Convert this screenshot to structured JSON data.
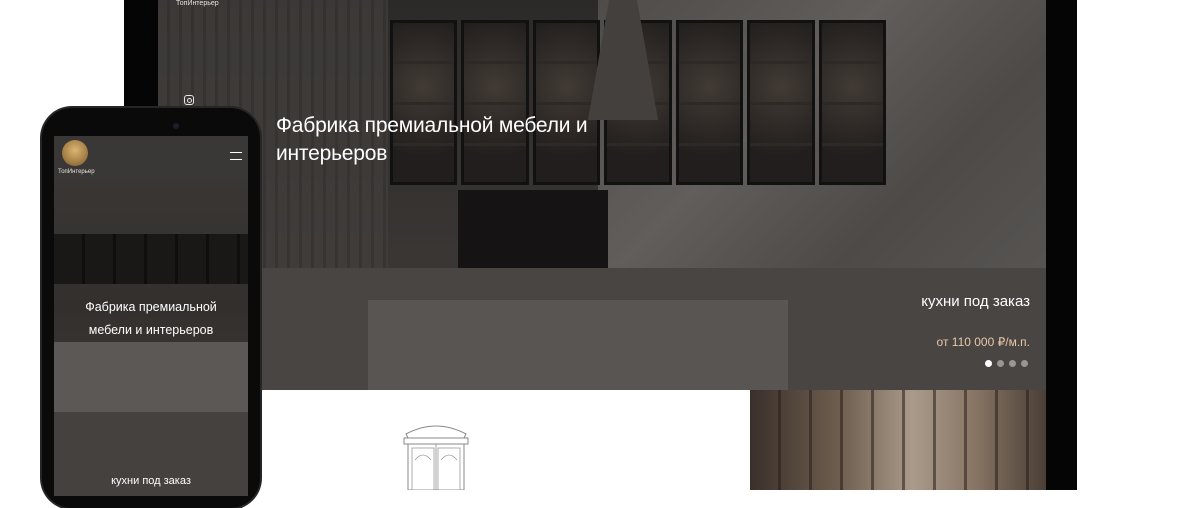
{
  "desktop": {
    "site": {
      "logo_text": "ТопИнтерьер"
    },
    "hero": {
      "title": "Фабрика премиальной мебели и интерьеров"
    },
    "slider": {
      "slide_title": "кухни под заказ",
      "slide_price": "от 110 000 ₽/м.п.",
      "total_slides": 4,
      "active_slide": 1
    }
  },
  "mobile": {
    "site": {
      "logo_text": "ТопИнтерьер"
    },
    "hero": {
      "title": "Фабрика премиальной мебели и интерьеров"
    },
    "slider": {
      "slide_title": "кухни под заказ"
    }
  },
  "icons": {
    "instagram": "instagram-icon",
    "menu": "hamburger-menu-icon",
    "logo": "tree-logo-icon"
  },
  "colors": {
    "price_accent": "#e8c8a8",
    "device_frame": "#050505",
    "hero_text": "#ffffff"
  }
}
